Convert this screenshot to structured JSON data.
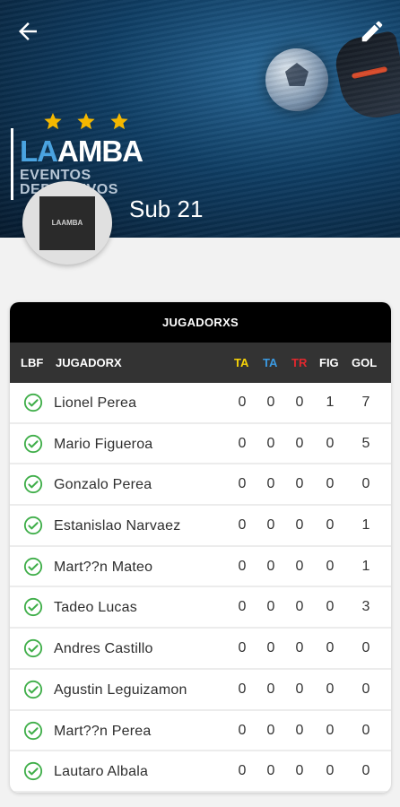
{
  "header": {
    "logo_main_la": "LA",
    "logo_main_amba": "AMBA",
    "logo_sub": "EVENTOS DEPORTIVOS",
    "team_name": "Sub 21",
    "avatar_text": "LAAMBA",
    "colors": {
      "accent": "#4aa3e0",
      "star": "#f5b800"
    }
  },
  "table": {
    "title": "JUGADORXS",
    "columns": {
      "lbf": "LBF",
      "player": "JUGADORX",
      "ta_yellow": "TA",
      "ta_blue": "TA",
      "tr": "TR",
      "fig": "FIG",
      "gol": "GOL"
    },
    "column_colors": {
      "ta_yellow": "#f7d308",
      "ta_blue": "#3b9ae1",
      "tr": "#e0282e"
    },
    "rows": [
      {
        "name": "Lionel Perea",
        "ta1": "0",
        "ta2": "0",
        "tr": "0",
        "fig": "1",
        "gol": "7"
      },
      {
        "name": "Mario Figueroa",
        "ta1": "0",
        "ta2": "0",
        "tr": "0",
        "fig": "0",
        "gol": "5"
      },
      {
        "name": "Gonzalo Perea",
        "ta1": "0",
        "ta2": "0",
        "tr": "0",
        "fig": "0",
        "gol": "0"
      },
      {
        "name": "Estanislao Narvaez",
        "ta1": "0",
        "ta2": "0",
        "tr": "0",
        "fig": "0",
        "gol": "1"
      },
      {
        "name": "Mart??n Mateo",
        "ta1": "0",
        "ta2": "0",
        "tr": "0",
        "fig": "0",
        "gol": "1"
      },
      {
        "name": "Tadeo Lucas",
        "ta1": "0",
        "ta2": "0",
        "tr": "0",
        "fig": "0",
        "gol": "3"
      },
      {
        "name": "Andres Castillo",
        "ta1": "0",
        "ta2": "0",
        "tr": "0",
        "fig": "0",
        "gol": "0"
      },
      {
        "name": "Agustin Leguizamon",
        "ta1": "0",
        "ta2": "0",
        "tr": "0",
        "fig": "0",
        "gol": "0"
      },
      {
        "name": "Mart??n Perea",
        "ta1": "0",
        "ta2": "0",
        "tr": "0",
        "fig": "0",
        "gol": "0"
      },
      {
        "name": "Lautaro Albala",
        "ta1": "0",
        "ta2": "0",
        "tr": "0",
        "fig": "0",
        "gol": "0"
      }
    ]
  },
  "icons": {
    "back": "arrow-left-icon",
    "edit": "pencil-icon",
    "check": "check-circle-icon",
    "star": "star-icon"
  }
}
